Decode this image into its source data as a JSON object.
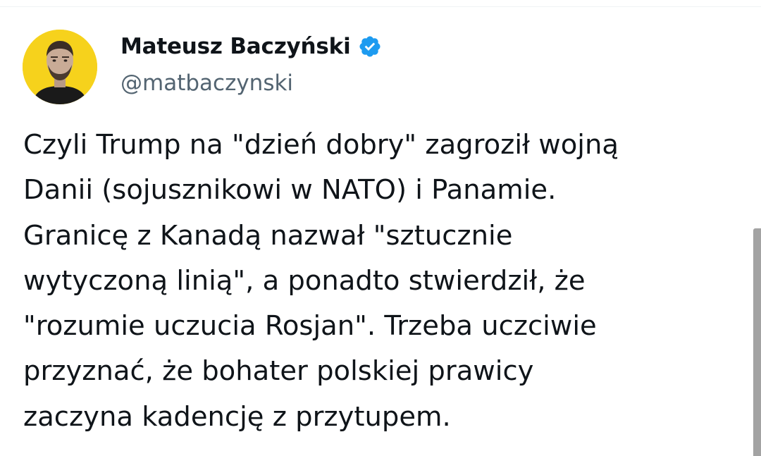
{
  "author": {
    "display_name": "Mateusz Baczyński",
    "handle": "@matbaczynski",
    "verified": true,
    "avatar_background": "#f6d21c"
  },
  "tweet": {
    "lines": [
      "Czyli Trump na \"dzień dobry\" zagroził wojną",
      "Danii (sojusznikowi w NATO) i Panamie.",
      "Granicę z Kanadą nazwał \"sztucznie",
      "wytyczoną linią\", a ponadto stwierdził, że",
      "\"rozumie uczucia Rosjan\". Trzeba uczciwie",
      "przyznać, że bohater polskiej prawicy",
      "zaczyna kadencję z przytupem."
    ]
  },
  "icons": {
    "verified": "verified-badge-icon",
    "avatar": "avatar"
  },
  "colors": {
    "text": "#0f1419",
    "secondary_text": "#536471",
    "verified_blue": "#1d9bf0",
    "scrollbar": "#a3a3a3"
  }
}
